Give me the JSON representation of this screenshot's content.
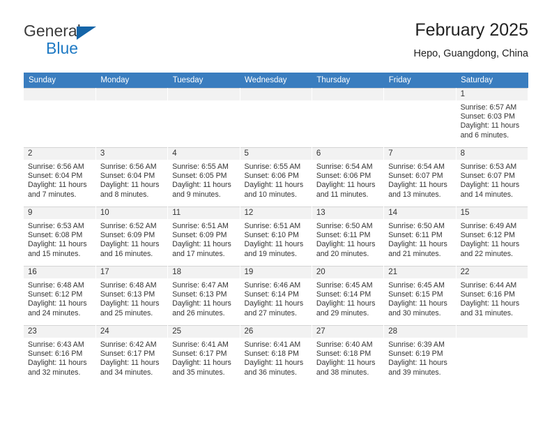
{
  "brand": {
    "name_top": "General",
    "name_bottom": "Blue",
    "accent_color": "#1f7ac4",
    "triangle_color": "#1565a8"
  },
  "header": {
    "title": "February 2025",
    "subtitle": "Hepo, Guangdong, China"
  },
  "calendar": {
    "header_bg": "#3a7dbf",
    "daynum_bg": "#f2f2f2",
    "weekdays": [
      "Sunday",
      "Monday",
      "Tuesday",
      "Wednesday",
      "Thursday",
      "Friday",
      "Saturday"
    ],
    "weeks": [
      [
        {
          "day": "",
          "sunrise": "",
          "sunset": "",
          "daylight": "",
          "blank": true
        },
        {
          "day": "",
          "sunrise": "",
          "sunset": "",
          "daylight": "",
          "blank": true
        },
        {
          "day": "",
          "sunrise": "",
          "sunset": "",
          "daylight": "",
          "blank": true
        },
        {
          "day": "",
          "sunrise": "",
          "sunset": "",
          "daylight": "",
          "blank": true
        },
        {
          "day": "",
          "sunrise": "",
          "sunset": "",
          "daylight": "",
          "blank": true
        },
        {
          "day": "",
          "sunrise": "",
          "sunset": "",
          "daylight": "",
          "blank": true
        },
        {
          "day": "1",
          "sunrise": "Sunrise: 6:57 AM",
          "sunset": "Sunset: 6:03 PM",
          "daylight": "Daylight: 11 hours and 6 minutes."
        }
      ],
      [
        {
          "day": "2",
          "sunrise": "Sunrise: 6:56 AM",
          "sunset": "Sunset: 6:04 PM",
          "daylight": "Daylight: 11 hours and 7 minutes."
        },
        {
          "day": "3",
          "sunrise": "Sunrise: 6:56 AM",
          "sunset": "Sunset: 6:04 PM",
          "daylight": "Daylight: 11 hours and 8 minutes."
        },
        {
          "day": "4",
          "sunrise": "Sunrise: 6:55 AM",
          "sunset": "Sunset: 6:05 PM",
          "daylight": "Daylight: 11 hours and 9 minutes."
        },
        {
          "day": "5",
          "sunrise": "Sunrise: 6:55 AM",
          "sunset": "Sunset: 6:06 PM",
          "daylight": "Daylight: 11 hours and 10 minutes."
        },
        {
          "day": "6",
          "sunrise": "Sunrise: 6:54 AM",
          "sunset": "Sunset: 6:06 PM",
          "daylight": "Daylight: 11 hours and 11 minutes."
        },
        {
          "day": "7",
          "sunrise": "Sunrise: 6:54 AM",
          "sunset": "Sunset: 6:07 PM",
          "daylight": "Daylight: 11 hours and 13 minutes."
        },
        {
          "day": "8",
          "sunrise": "Sunrise: 6:53 AM",
          "sunset": "Sunset: 6:07 PM",
          "daylight": "Daylight: 11 hours and 14 minutes."
        }
      ],
      [
        {
          "day": "9",
          "sunrise": "Sunrise: 6:53 AM",
          "sunset": "Sunset: 6:08 PM",
          "daylight": "Daylight: 11 hours and 15 minutes."
        },
        {
          "day": "10",
          "sunrise": "Sunrise: 6:52 AM",
          "sunset": "Sunset: 6:09 PM",
          "daylight": "Daylight: 11 hours and 16 minutes."
        },
        {
          "day": "11",
          "sunrise": "Sunrise: 6:51 AM",
          "sunset": "Sunset: 6:09 PM",
          "daylight": "Daylight: 11 hours and 17 minutes."
        },
        {
          "day": "12",
          "sunrise": "Sunrise: 6:51 AM",
          "sunset": "Sunset: 6:10 PM",
          "daylight": "Daylight: 11 hours and 19 minutes."
        },
        {
          "day": "13",
          "sunrise": "Sunrise: 6:50 AM",
          "sunset": "Sunset: 6:11 PM",
          "daylight": "Daylight: 11 hours and 20 minutes."
        },
        {
          "day": "14",
          "sunrise": "Sunrise: 6:50 AM",
          "sunset": "Sunset: 6:11 PM",
          "daylight": "Daylight: 11 hours and 21 minutes."
        },
        {
          "day": "15",
          "sunrise": "Sunrise: 6:49 AM",
          "sunset": "Sunset: 6:12 PM",
          "daylight": "Daylight: 11 hours and 22 minutes."
        }
      ],
      [
        {
          "day": "16",
          "sunrise": "Sunrise: 6:48 AM",
          "sunset": "Sunset: 6:12 PM",
          "daylight": "Daylight: 11 hours and 24 minutes."
        },
        {
          "day": "17",
          "sunrise": "Sunrise: 6:48 AM",
          "sunset": "Sunset: 6:13 PM",
          "daylight": "Daylight: 11 hours and 25 minutes."
        },
        {
          "day": "18",
          "sunrise": "Sunrise: 6:47 AM",
          "sunset": "Sunset: 6:13 PM",
          "daylight": "Daylight: 11 hours and 26 minutes."
        },
        {
          "day": "19",
          "sunrise": "Sunrise: 6:46 AM",
          "sunset": "Sunset: 6:14 PM",
          "daylight": "Daylight: 11 hours and 27 minutes."
        },
        {
          "day": "20",
          "sunrise": "Sunrise: 6:45 AM",
          "sunset": "Sunset: 6:14 PM",
          "daylight": "Daylight: 11 hours and 29 minutes."
        },
        {
          "day": "21",
          "sunrise": "Sunrise: 6:45 AM",
          "sunset": "Sunset: 6:15 PM",
          "daylight": "Daylight: 11 hours and 30 minutes."
        },
        {
          "day": "22",
          "sunrise": "Sunrise: 6:44 AM",
          "sunset": "Sunset: 6:16 PM",
          "daylight": "Daylight: 11 hours and 31 minutes."
        }
      ],
      [
        {
          "day": "23",
          "sunrise": "Sunrise: 6:43 AM",
          "sunset": "Sunset: 6:16 PM",
          "daylight": "Daylight: 11 hours and 32 minutes."
        },
        {
          "day": "24",
          "sunrise": "Sunrise: 6:42 AM",
          "sunset": "Sunset: 6:17 PM",
          "daylight": "Daylight: 11 hours and 34 minutes."
        },
        {
          "day": "25",
          "sunrise": "Sunrise: 6:41 AM",
          "sunset": "Sunset: 6:17 PM",
          "daylight": "Daylight: 11 hours and 35 minutes."
        },
        {
          "day": "26",
          "sunrise": "Sunrise: 6:41 AM",
          "sunset": "Sunset: 6:18 PM",
          "daylight": "Daylight: 11 hours and 36 minutes."
        },
        {
          "day": "27",
          "sunrise": "Sunrise: 6:40 AM",
          "sunset": "Sunset: 6:18 PM",
          "daylight": "Daylight: 11 hours and 38 minutes."
        },
        {
          "day": "28",
          "sunrise": "Sunrise: 6:39 AM",
          "sunset": "Sunset: 6:19 PM",
          "daylight": "Daylight: 11 hours and 39 minutes."
        },
        {
          "day": "",
          "sunrise": "",
          "sunset": "",
          "daylight": "",
          "blank": true
        }
      ]
    ]
  }
}
